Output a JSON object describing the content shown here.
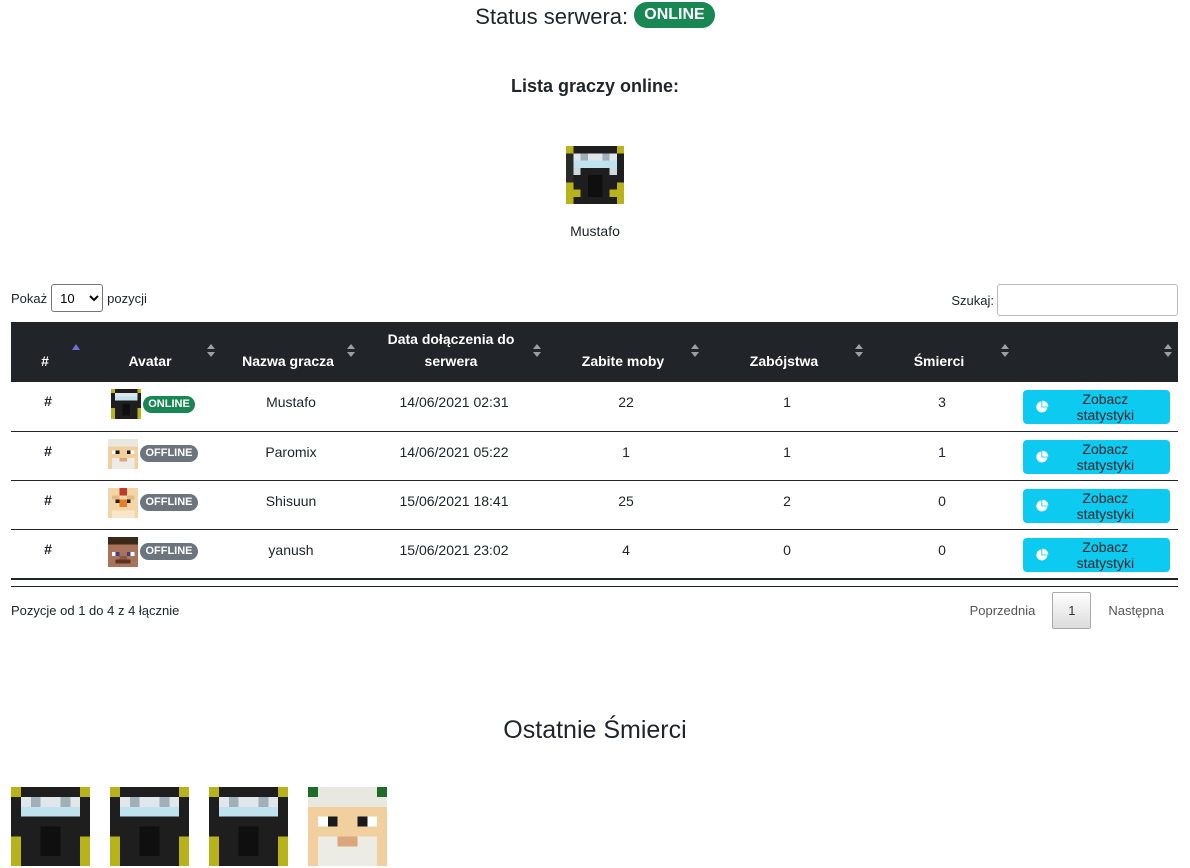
{
  "status": {
    "label": "Status serwera:",
    "badge": "ONLINE"
  },
  "online_list": {
    "title": "Lista graczy online:",
    "players": [
      {
        "name": "Mustafo",
        "skin": "ninja-head-icon"
      }
    ]
  },
  "controls": {
    "show_label": "Pokaż",
    "show_value": "10",
    "show_options": [
      "10"
    ],
    "entries_label": "pozycji",
    "search_label": "Szukaj:",
    "search_value": ""
  },
  "table": {
    "headers": [
      "#",
      "Avatar",
      "Nazwa gracza",
      "Data dołączenia do serwera",
      "Zabite moby",
      "Zabójstwa",
      "Śmierci",
      ""
    ],
    "rows": [
      {
        "hash": "#",
        "skin": "ninja-head-icon",
        "status": "ONLINE",
        "name": "Mustafo",
        "joined": "14/06/2021 02:31",
        "mobs": "22",
        "kills": "1",
        "deaths": "3",
        "button": "Zobacz statystyki"
      },
      {
        "hash": "#",
        "skin": "old-man-head-icon",
        "status": "OFFLINE",
        "name": "Paromix",
        "joined": "14/06/2021 05:22",
        "mobs": "1",
        "kills": "1",
        "deaths": "1",
        "button": "Zobacz statystyki"
      },
      {
        "hash": "#",
        "skin": "chicken-head-icon",
        "status": "OFFLINE",
        "name": "Shisuun",
        "joined": "15/06/2021 18:41",
        "mobs": "25",
        "kills": "2",
        "deaths": "0",
        "button": "Zobacz statystyki"
      },
      {
        "hash": "#",
        "skin": "steve-head-icon",
        "status": "OFFLINE",
        "name": "yanush",
        "joined": "15/06/2021 23:02",
        "mobs": "4",
        "kills": "0",
        "deaths": "0",
        "button": "Zobacz statystyki"
      }
    ]
  },
  "info": "Pozycje od 1 do 4 z 4 łącznie",
  "pagination": {
    "prev": "Poprzednia",
    "current": "1",
    "next": "Następna"
  },
  "recent_deaths": {
    "title": "Ostatnie Śmierci",
    "heads": [
      "ninja-head-icon",
      "ninja-head-icon",
      "ninja-head-icon",
      "old-man-head-icon"
    ]
  },
  "colors": {
    "online": "#198754",
    "offline": "#6c757d",
    "header_bg": "#212529",
    "button": "#0dcaf0"
  }
}
